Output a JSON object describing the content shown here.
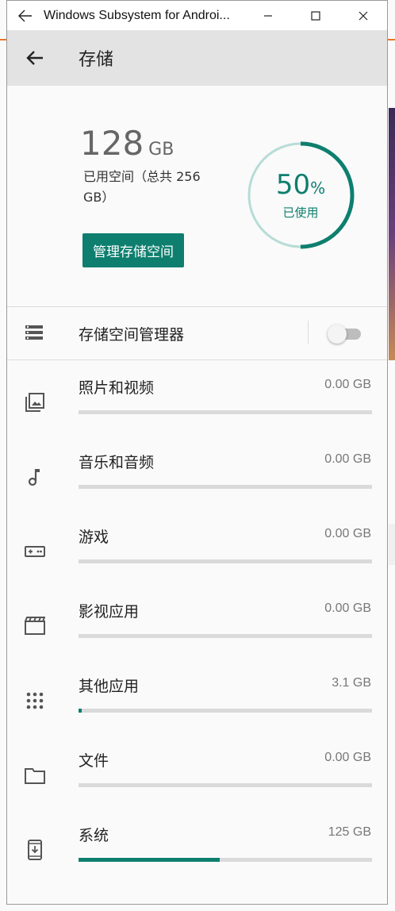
{
  "window": {
    "title": "Windows Subsystem for Androi..."
  },
  "appbar": {
    "title": "存储"
  },
  "summary": {
    "used_value": "128",
    "used_unit": "GB",
    "used_text": "已用空间（总共 256 GB）",
    "manage_button": "管理存储空间",
    "percent_value": "50",
    "percent_sign": "%",
    "percent_label": "已使用",
    "percent_fraction": 0.5
  },
  "storage_manager": {
    "label": "存储空间管理器",
    "enabled": false
  },
  "categories": [
    {
      "name": "照片和视频",
      "size": "0.00 GB",
      "fraction": 0,
      "icon": "photo-library-icon"
    },
    {
      "name": "音乐和音频",
      "size": "0.00 GB",
      "fraction": 0,
      "icon": "music-note-icon"
    },
    {
      "name": "游戏",
      "size": "0.00 GB",
      "fraction": 0,
      "icon": "gamepad-icon"
    },
    {
      "name": "影视应用",
      "size": "0.00 GB",
      "fraction": 0,
      "icon": "movie-icon"
    },
    {
      "name": "其他应用",
      "size": "3.1 GB",
      "fraction": 0.0097,
      "icon": "apps-grid-icon"
    },
    {
      "name": "文件",
      "size": "0.00 GB",
      "fraction": 0,
      "icon": "folder-icon"
    },
    {
      "name": "系统",
      "size": "125 GB",
      "fraction": 0.48,
      "icon": "system-update-icon"
    }
  ],
  "colors": {
    "accent": "#0e7f6f",
    "ring_track": "#b7dcd6",
    "appbar_bg": "#e3e3e3",
    "background_accent": "#e8732c"
  }
}
